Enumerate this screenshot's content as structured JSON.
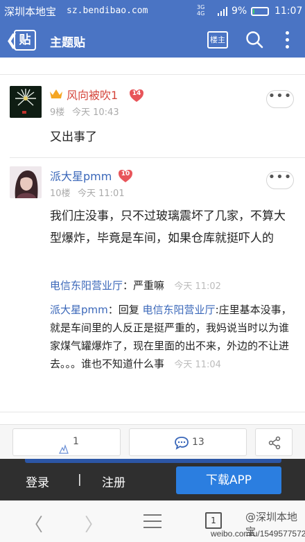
{
  "status_bar": {
    "watermark": "深圳本地宝",
    "watermark_url": "sz.bendibao.com",
    "signal_labels": [
      "3G",
      "4G"
    ],
    "battery": "9%",
    "time": "11:07",
    "battery_level": 0.09
  },
  "header": {
    "logo_text": "贴",
    "title": "主题贴",
    "owner_only_label": "楼主",
    "icons": [
      "back-chevron-icon",
      "search-icon",
      "more-vertical-icon"
    ]
  },
  "posts": [
    {
      "username": "风向被吹1",
      "level": "14",
      "floor": "9楼",
      "time": "今天 10:43",
      "body": "又出事了",
      "more_label": "•••"
    },
    {
      "username": "派大星pmm",
      "level": "10",
      "floor": "10楼",
      "time": "今天 11:01",
      "body": "我们庄没事，只不过玻璃震坏了几家，不算大型爆炸，毕竟是车间，如果仓库就挺吓人的",
      "more_label": "•••",
      "replies": [
        {
          "user": "电信东阳营业厅",
          "sep": "：",
          "text": "严重嘛",
          "time": "今天 11:02"
        },
        {
          "user": "派大星pmm",
          "sep": "：",
          "prefix": "回复 ",
          "target": "电信东阳营业厅",
          "text": ":庄里基本没事，就是车间里的人反正是挺严重的，我妈说当时以为谁家煤气罐爆炸了，现在里面的出不来，外边的不让进去。。。谁也不知道什么事",
          "time": "今天 11:04"
        }
      ]
    }
  ],
  "action_bar": {
    "like_count": "1",
    "comment_count": "13"
  },
  "login_bar": {
    "login": "登录",
    "separator": "|",
    "register": "注册",
    "download": "下载APP"
  },
  "browser_nav": {
    "tab_count": "1",
    "watermark_handle": "@深圳本地宝",
    "watermark_url": "weibo.com/u/1549577572"
  },
  "colors": {
    "header_blue": "#4a74c4",
    "username_blue": "#3a67b9",
    "level_badge_red": "#e8555a",
    "download_blue": "#2b7ee0"
  }
}
